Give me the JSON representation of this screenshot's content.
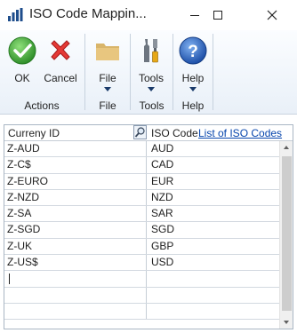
{
  "window": {
    "title": "ISO Code Mappin...",
    "icon": "bar-chart-app-icon",
    "controls": [
      "minimize",
      "maximize",
      "close"
    ]
  },
  "ribbon": {
    "groups": [
      {
        "label": "Actions",
        "buttons": [
          {
            "label": "OK",
            "icon": "green-check-icon"
          },
          {
            "label": "Cancel",
            "icon": "red-x-icon"
          }
        ]
      },
      {
        "label": "File",
        "buttons": [
          {
            "label": "File",
            "icon": "folder-icon",
            "dropdown": true
          }
        ]
      },
      {
        "label": "Tools",
        "buttons": [
          {
            "label": "Tools",
            "icon": "tools-icon",
            "dropdown": true
          }
        ]
      },
      {
        "label": "Help",
        "buttons": [
          {
            "label": "Help",
            "icon": "help-icon",
            "dropdown": true
          }
        ]
      }
    ],
    "colors": {
      "ribbon_top": "#fbfdff",
      "ribbon_bottom": "#e9f0f8"
    }
  },
  "grid": {
    "headers": {
      "currency_id": "Curreny ID",
      "iso_code": "ISO Code",
      "iso_link": "List of ISO Codes"
    },
    "rows": [
      {
        "currency_id": "Z-AUD",
        "iso_code": "AUD"
      },
      {
        "currency_id": "Z-C$",
        "iso_code": "CAD"
      },
      {
        "currency_id": "Z-EURO",
        "iso_code": "EUR"
      },
      {
        "currency_id": "Z-NZD",
        "iso_code": "NZD"
      },
      {
        "currency_id": "Z-SA",
        "iso_code": "SAR"
      },
      {
        "currency_id": "Z-SGD",
        "iso_code": "SGD"
      },
      {
        "currency_id": "Z-UK",
        "iso_code": "GBP"
      },
      {
        "currency_id": "Z-US$",
        "iso_code": "USD"
      },
      {
        "currency_id": "",
        "iso_code": ""
      },
      {
        "currency_id": "",
        "iso_code": ""
      },
      {
        "currency_id": "",
        "iso_code": ""
      }
    ],
    "link_color": "#0645ad"
  }
}
